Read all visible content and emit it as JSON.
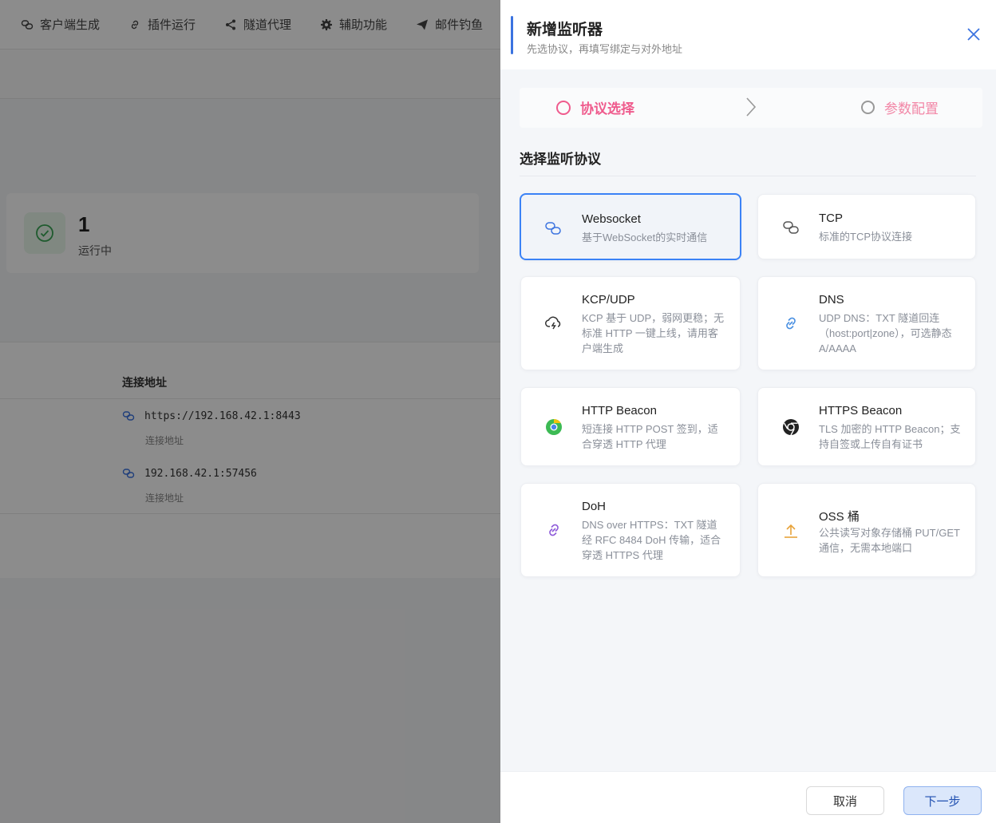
{
  "background": {
    "nav": [
      {
        "label": "客户端生成",
        "icon": "chain-icon"
      },
      {
        "label": "插件运行",
        "icon": "link-icon"
      },
      {
        "label": "隧道代理",
        "icon": "share-icon"
      },
      {
        "label": "辅助功能",
        "icon": "gear-icon"
      },
      {
        "label": "邮件钓鱼",
        "icon": "send-icon"
      }
    ],
    "stat": {
      "value": "1",
      "label": "运行中"
    },
    "table": {
      "header": "连接地址",
      "rows": [
        {
          "address": "https://192.168.42.1:8443",
          "sub": "连接地址"
        },
        {
          "address": "192.168.42.1:57456",
          "sub": "连接地址"
        }
      ]
    }
  },
  "drawer": {
    "title": "新增监听器",
    "subtitle": "先选协议，再填写绑定与对外地址",
    "steps": [
      {
        "label": "协议选择",
        "active": true
      },
      {
        "label": "参数配置",
        "active": false
      }
    ],
    "section_title": "选择监听协议",
    "protocols": [
      {
        "name": "Websocket",
        "desc": "基于WebSocket的实时通信",
        "icon": "chain-icon",
        "selected": true
      },
      {
        "name": "TCP",
        "desc": "标准的TCP协议连接",
        "icon": "chain-icon",
        "selected": false
      },
      {
        "name": "KCP/UDP",
        "desc": "KCP 基于 UDP，弱网更稳；无标准 HTTP 一键上线，请用客户端生成",
        "icon": "cloud-lightning-icon",
        "selected": false
      },
      {
        "name": "DNS",
        "desc": "UDP DNS：TXT 隧道回连（host:port|zone），可选静态 A/AAAA",
        "icon": "link-icon",
        "selected": false
      },
      {
        "name": "HTTP Beacon",
        "desc": "短连接 HTTP POST 签到，适合穿透 HTTP 代理",
        "icon": "chrome-icon",
        "selected": false
      },
      {
        "name": "HTTPS Beacon",
        "desc": "TLS 加密的 HTTP Beacon；支持自签或上传自有证书",
        "icon": "chrome-icon",
        "selected": false
      },
      {
        "name": "DoH",
        "desc": "DNS over HTTPS：TXT 隧道经 RFC 8484 DoH 传输，适合穿透 HTTPS 代理",
        "icon": "link-icon",
        "selected": false
      },
      {
        "name": "OSS 桶",
        "desc": "公共读写对象存储桶 PUT/GET 通信，无需本地端口",
        "icon": "upload-icon",
        "selected": false
      }
    ],
    "footer": {
      "cancel": "取消",
      "next": "下一步"
    },
    "colors": {
      "accent": "#3b82f6",
      "step_active": "#ef5b8d",
      "head_bar": "#3b73e0"
    }
  }
}
